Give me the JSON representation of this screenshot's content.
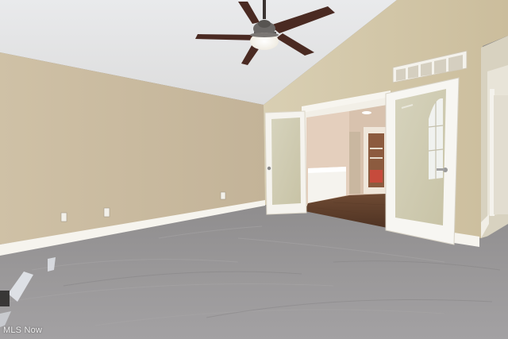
{
  "photo": {
    "subject": "empty-bedroom",
    "watermark": "MLS Now"
  }
}
